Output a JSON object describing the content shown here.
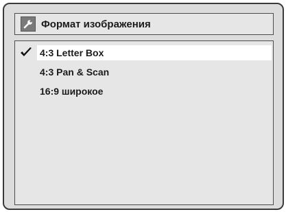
{
  "header": {
    "title": "Формат изображения",
    "icon": "wrench-icon"
  },
  "menu": {
    "items": [
      {
        "label": "4:3 Letter Box",
        "selected": true
      },
      {
        "label": "4:3 Pan & Scan",
        "selected": false
      },
      {
        "label": "16:9 широкое",
        "selected": false
      }
    ],
    "check_icon": "checkmark-icon"
  }
}
